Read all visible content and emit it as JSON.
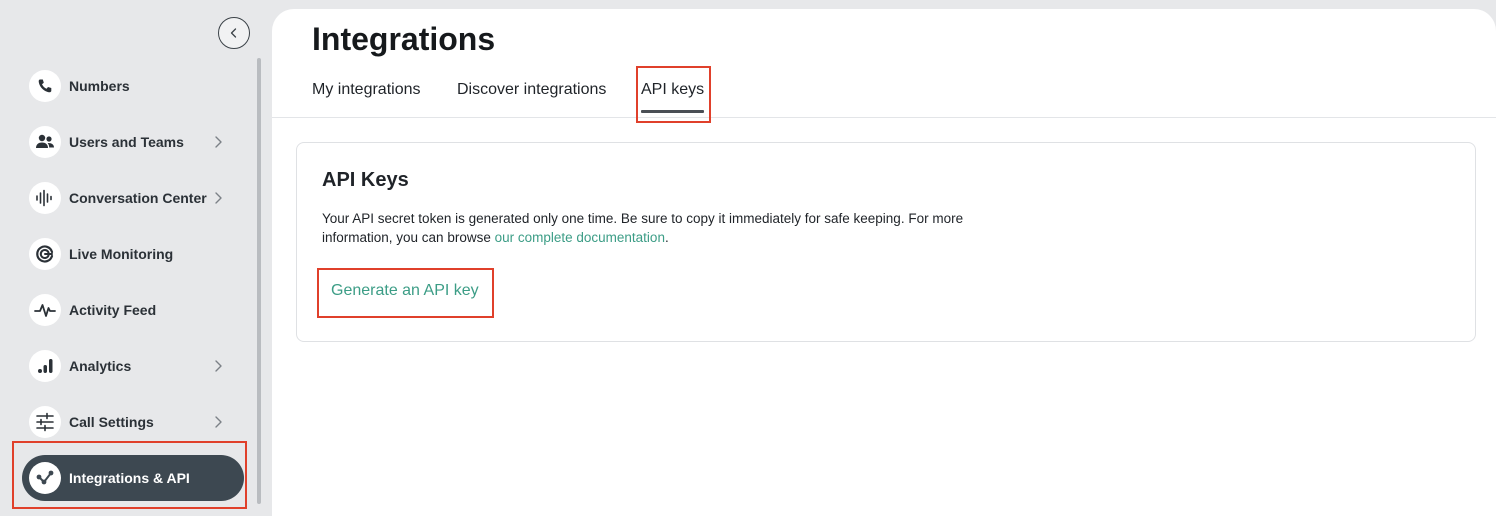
{
  "sidebar": {
    "items": [
      {
        "label": "Numbers",
        "icon": "phone-icon",
        "has_chevron": false
      },
      {
        "label": "Users and Teams",
        "icon": "users-icon",
        "has_chevron": true
      },
      {
        "label": "Conversation Center",
        "icon": "waveform-icon",
        "has_chevron": true
      },
      {
        "label": "Live Monitoring",
        "icon": "radar-icon",
        "has_chevron": false
      },
      {
        "label": "Activity Feed",
        "icon": "pulse-icon",
        "has_chevron": false
      },
      {
        "label": "Analytics",
        "icon": "bar-chart-icon",
        "has_chevron": true
      },
      {
        "label": "Call Settings",
        "icon": "sliders-icon",
        "has_chevron": true
      },
      {
        "label": "Integrations & API",
        "icon": "integrations-icon",
        "has_chevron": false,
        "active": true
      }
    ]
  },
  "page": {
    "title": "Integrations"
  },
  "tabs": [
    {
      "label": "My integrations"
    },
    {
      "label": "Discover integrations"
    },
    {
      "label": "API keys",
      "active": true
    }
  ],
  "card": {
    "title": "API Keys",
    "description": "Your API secret token is generated only one time. Be sure to copy it immediately for safe keeping. For more information, you can browse ",
    "doc_link": "our complete documentation",
    "description_end": ".",
    "generate_label": "Generate an API key"
  },
  "colors": {
    "accent": "#3c9d86",
    "active_nav": "#3d4851",
    "highlight": "#e0402b"
  }
}
